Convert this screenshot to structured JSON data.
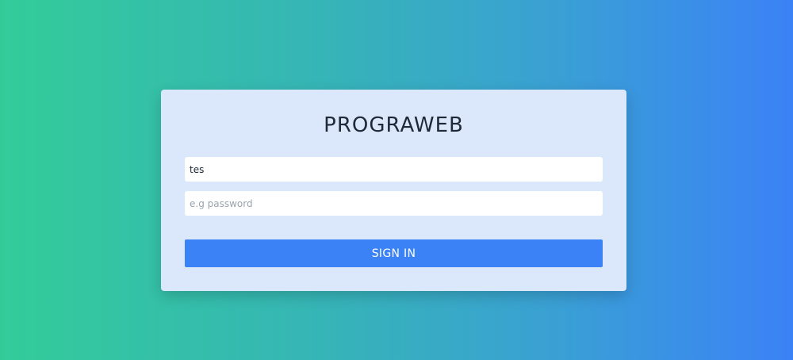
{
  "login": {
    "title": "PROGRAWEB",
    "username": {
      "value": "tes",
      "placeholder": ""
    },
    "password": {
      "value": "",
      "placeholder": "e.g password"
    },
    "signin_label": "SIGN IN"
  },
  "colors": {
    "background_start": "#33cc99",
    "background_end": "#3b82f6",
    "card_background": "#dbe8fb",
    "button_background": "#3b82f6",
    "title_text": "#1f2937"
  }
}
